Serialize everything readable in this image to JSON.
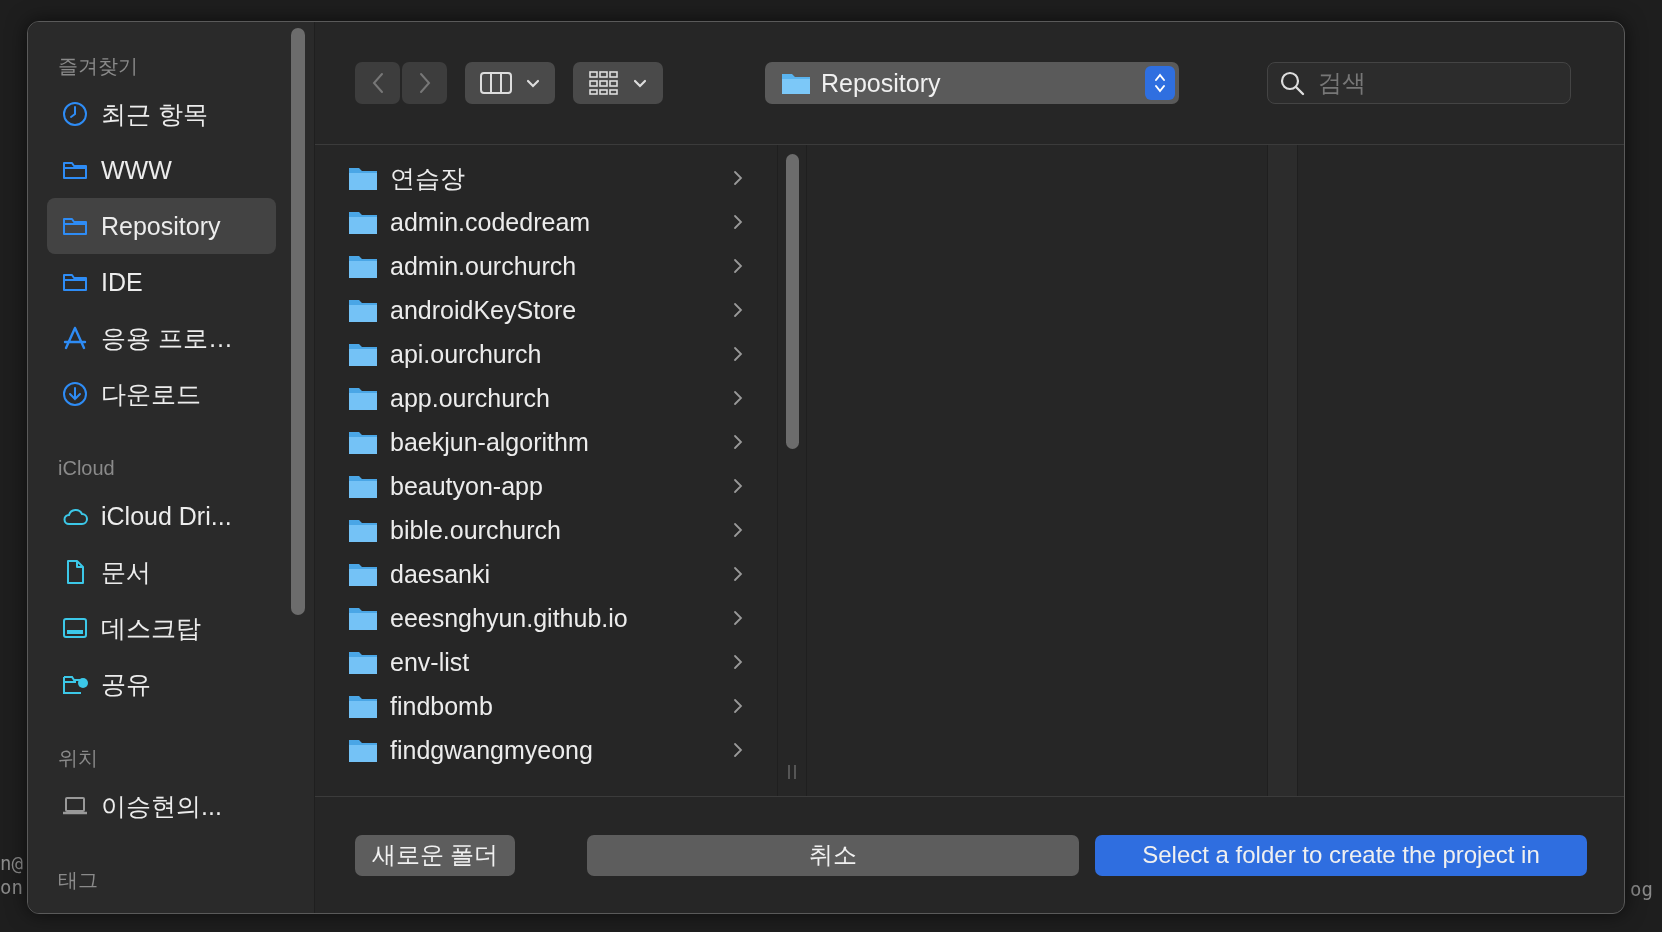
{
  "background_terminal": {
    "texts": [
      "n@",
      "on",
      "og"
    ]
  },
  "sidebar": {
    "sections": [
      {
        "heading": "즐겨찾기",
        "items": [
          {
            "label": "최근 항목",
            "kind": "clock",
            "selected": false
          },
          {
            "label": "WWW",
            "kind": "folder",
            "selected": false
          },
          {
            "label": "Repository",
            "kind": "folder",
            "selected": true
          },
          {
            "label": "IDE",
            "kind": "folder",
            "selected": false
          },
          {
            "label": "응용 프로…",
            "kind": "apps",
            "selected": false
          },
          {
            "label": "다운로드",
            "kind": "download",
            "selected": false
          }
        ]
      },
      {
        "heading": "iCloud",
        "items": [
          {
            "label": "iCloud Dri...",
            "kind": "cloud",
            "selected": false
          },
          {
            "label": "문서",
            "kind": "document",
            "selected": false
          },
          {
            "label": "데스크탑",
            "kind": "desktop",
            "selected": false
          },
          {
            "label": "공유",
            "kind": "shared",
            "selected": false
          }
        ]
      },
      {
        "heading": "위치",
        "items": [
          {
            "label": "이승현의...",
            "kind": "laptop",
            "selected": false
          }
        ]
      },
      {
        "heading": "태그"
      }
    ]
  },
  "toolbar": {
    "location": "Repository",
    "search": {
      "placeholder": "검색"
    }
  },
  "files": [
    {
      "name": "연습장"
    },
    {
      "name": "admin.codedream"
    },
    {
      "name": "admin.ourchurch"
    },
    {
      "name": "androidKeyStore"
    },
    {
      "name": "api.ourchurch"
    },
    {
      "name": "app.ourchurch"
    },
    {
      "name": "baekjun-algorithm"
    },
    {
      "name": "beautyon-app"
    },
    {
      "name": "bible.ourchurch"
    },
    {
      "name": "daesanki"
    },
    {
      "name": "eeesnghyun.github.io"
    },
    {
      "name": "env-list"
    },
    {
      "name": "findbomb"
    },
    {
      "name": "findgwangmyeong"
    }
  ],
  "buttons": [
    {
      "label": "새로운 폴더",
      "kind": "secondary"
    },
    {
      "label": "취소",
      "kind": "cancel"
    },
    {
      "label": "Select a folder to create the project in",
      "kind": "primary"
    }
  ]
}
